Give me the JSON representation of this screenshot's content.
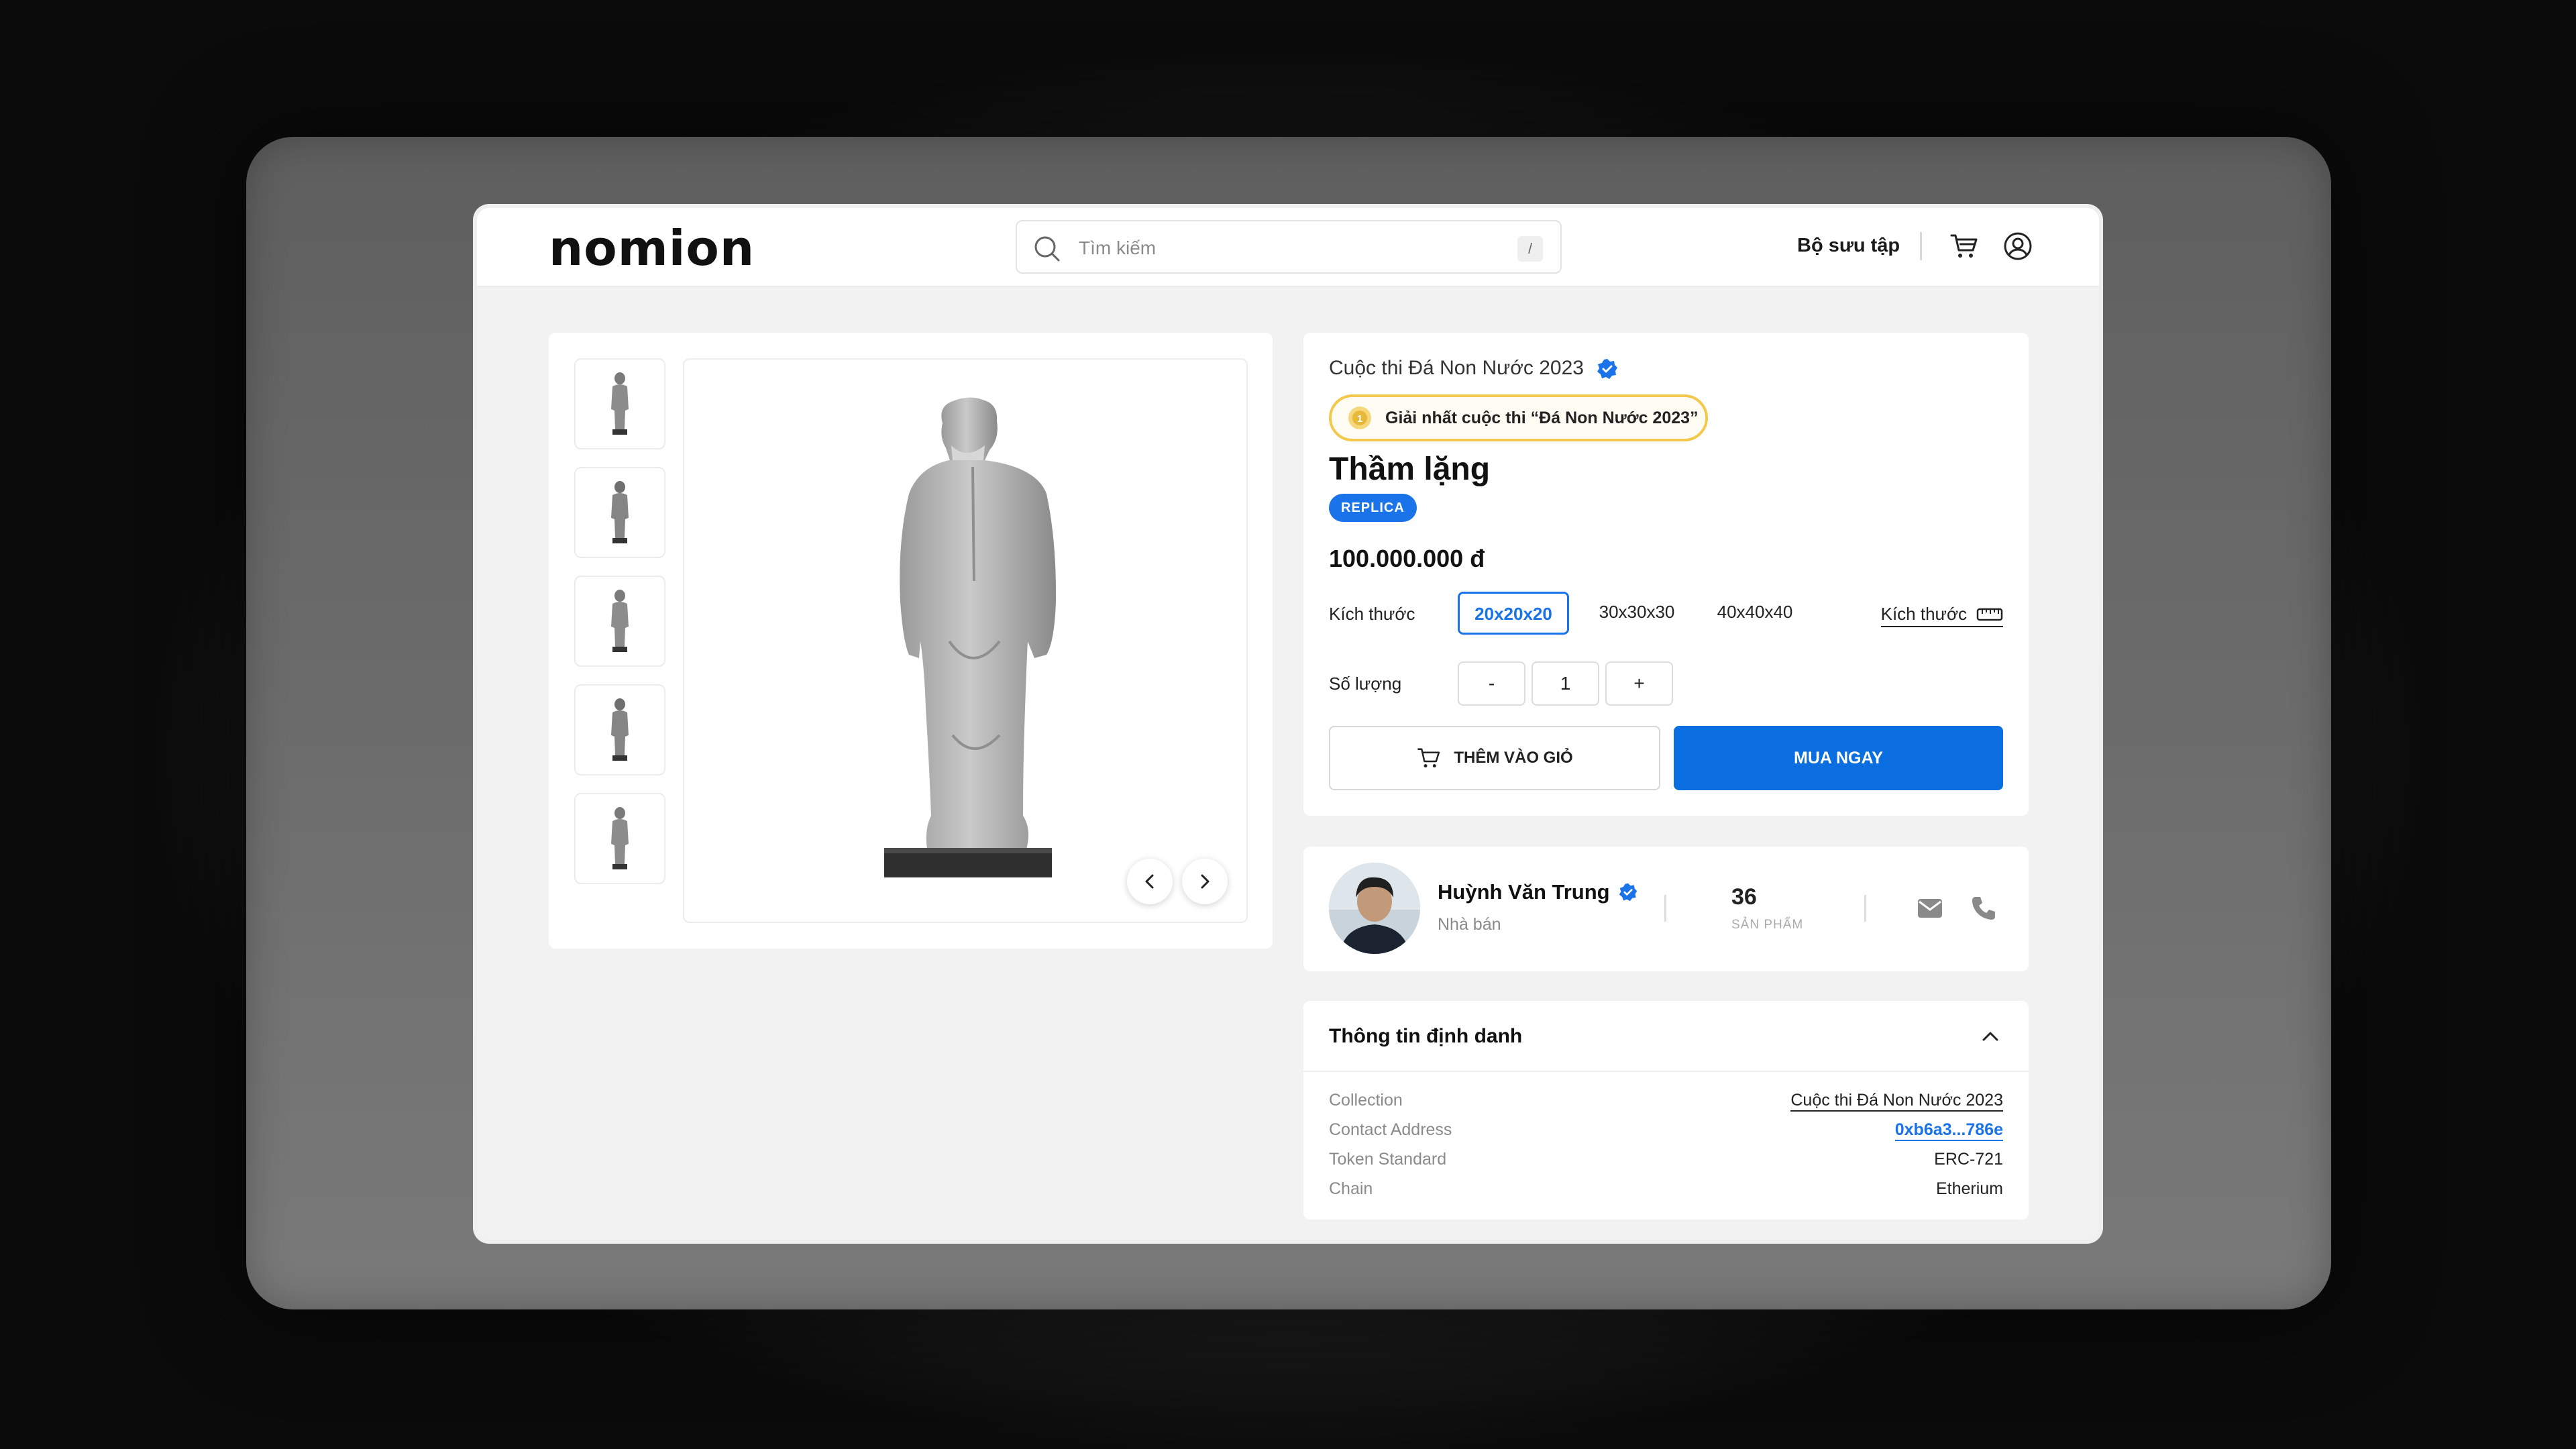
{
  "header": {
    "logo": "nomion",
    "search_placeholder": "Tìm kiếm",
    "search_shortcut": "/",
    "nav_collection": "Bộ sưu tập"
  },
  "product": {
    "collection_name": "Cuộc thi Đá Non Nước 2023",
    "award": "Giải nhất cuộc thi “Đá Non Nước 2023”",
    "title": "Thầm lặng",
    "badge": "REPLICA",
    "price": "100.000.000 đ",
    "size_label": "Kích thước",
    "sizes": [
      "20x20x20",
      "30x30x30",
      "40x40x40"
    ],
    "selected_size": "20x20x20",
    "size_guide": "Kích thước",
    "quantity_label": "Số lượng",
    "quantity_minus": "-",
    "quantity": "1",
    "quantity_plus": "+",
    "add_to_cart": "THÊM VÀO GIỎ",
    "buy_now": "MUA NGAY"
  },
  "gallery": {
    "thumbnail_count": 5
  },
  "seller": {
    "name": "Huỳnh Văn Trung",
    "role": "Nhà bán",
    "product_count": "36",
    "product_unit": "SẢN PHẨM"
  },
  "identity": {
    "title": "Thông tin định danh",
    "rows": [
      {
        "key": "Collection",
        "value": "Cuộc thi Đá Non Nước 2023"
      },
      {
        "key": "Contact Address",
        "value": "0xb6a3...786e"
      },
      {
        "key": "Token Standard",
        "value": "ERC-721"
      },
      {
        "key": "Chain",
        "value": "Etherium"
      }
    ]
  },
  "colors": {
    "accent": "#1a73e8",
    "award_border": "#f2c94c"
  }
}
